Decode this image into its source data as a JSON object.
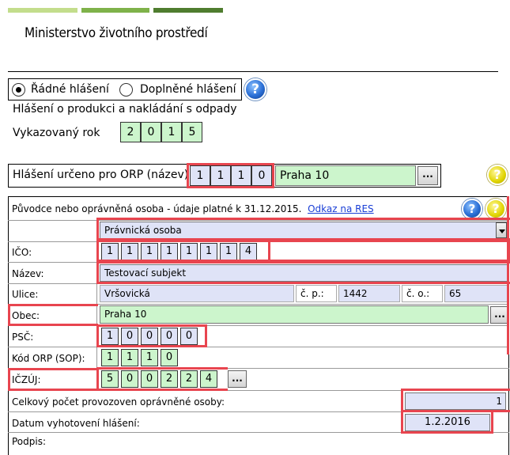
{
  "header": {
    "stripe_colors": [
      "#c3dd8c",
      "#7fb24a",
      "#4f7d2f"
    ],
    "ministry": "Ministerstvo životního prostředí"
  },
  "report_type": {
    "option_regular": "Řádné hlášení",
    "option_supplementary": "Doplněné hlášení",
    "selected": "Řádné hlášení"
  },
  "report_title": "Hlášení o produkci a nakládání s odpady",
  "year": {
    "label": "Vykazovaný rok",
    "digits": [
      "2",
      "0",
      "1",
      "5"
    ]
  },
  "orp": {
    "label": "Hlášení určeno pro ORP (název)",
    "digits": [
      "1",
      "1",
      "1",
      "0"
    ],
    "name": "Praha 10",
    "button": "..."
  },
  "originator": {
    "header": "Původce nebo oprávněná osoba - údaje platné k 31.12.2015.",
    "link": "Odkaz na RES",
    "entity_type": "Právnická osoba",
    "ico_label": "IČO:",
    "ico_digits": [
      "1",
      "1",
      "1",
      "1",
      "1",
      "1",
      "1",
      "4"
    ],
    "name_label": "Název:",
    "name_value": "Testovací subjekt",
    "street_label": "Ulice:",
    "street_value": "Vršovická",
    "cp_label": "č. p.:",
    "cp_value": "1442",
    "co_label": "č. o.:",
    "co_value": "65",
    "city_label": "Obec:",
    "city_value": "Praha 10",
    "city_button": "...",
    "psc_label": "PSČ:",
    "psc_digits": [
      "1",
      "0",
      "0",
      "0",
      "0"
    ],
    "orp_code_label": "Kód ORP (SOP):",
    "orp_code_digits": [
      "1",
      "1",
      "1",
      "0"
    ],
    "iczuj_label": "IČZÚJ:",
    "iczuj_digits": [
      "5",
      "0",
      "0",
      "2",
      "2",
      "4"
    ],
    "iczuj_button": "...",
    "total_label": "Celkový počet provozoven oprávněné osoby:",
    "total_value": "1",
    "date_label": "Datum vyhotovení hlášení:",
    "date_value": "1.2.2016",
    "signature_label": "Podpis:"
  },
  "icons": {
    "help": "?",
    "warning": "?"
  }
}
